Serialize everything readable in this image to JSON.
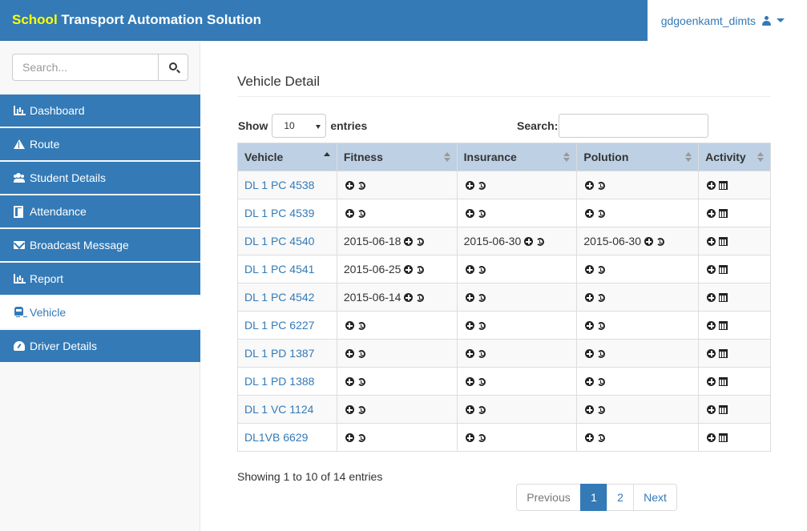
{
  "app": {
    "brand_accent": "School",
    "brand_rest": " Transport Automation Solution",
    "username": "gdgoenkamt_dimts"
  },
  "colors": {
    "primary": "#337ab7",
    "accent": "#ffff00",
    "table_header": "#bdd0e4"
  },
  "sidebar": {
    "search_placeholder": "Search...",
    "items": [
      {
        "label": "Dashboard",
        "icon": "bar-chart-icon"
      },
      {
        "label": "Route",
        "icon": "road-icon"
      },
      {
        "label": "Student Details",
        "icon": "users-icon"
      },
      {
        "label": "Attendance",
        "icon": "files-icon"
      },
      {
        "label": "Broadcast Message",
        "icon": "envelope-icon"
      },
      {
        "label": "Report",
        "icon": "bar-chart-icon"
      },
      {
        "label": "Vehicle",
        "icon": "bus-icon",
        "active": true
      },
      {
        "label": "Driver Details",
        "icon": "dashboard-icon"
      }
    ]
  },
  "main": {
    "title": "Vehicle Detail",
    "show_label": "Show",
    "entries_value": "10",
    "entries_label": "entries",
    "search_label": "Search:",
    "columns": [
      "Vehicle",
      "Fitness",
      "Insurance",
      "Polution",
      "Activity"
    ],
    "rows": [
      {
        "vehicle": "DL 1 PC 4538",
        "fitness": "",
        "insurance": "",
        "polution": ""
      },
      {
        "vehicle": "DL 1 PC 4539",
        "fitness": "",
        "insurance": "",
        "polution": ""
      },
      {
        "vehicle": "DL 1 PC 4540",
        "fitness": "2015-06-18",
        "insurance": "2015-06-30",
        "polution": "2015-06-30"
      },
      {
        "vehicle": "DL 1 PC 4541",
        "fitness": "2015-06-25",
        "insurance": "",
        "polution": ""
      },
      {
        "vehicle": "DL 1 PC 4542",
        "fitness": "2015-06-14",
        "insurance": "",
        "polution": ""
      },
      {
        "vehicle": "DL 1 PC 6227",
        "fitness": "",
        "insurance": "",
        "polution": ""
      },
      {
        "vehicle": "DL 1 PD 1387",
        "fitness": "",
        "insurance": "",
        "polution": ""
      },
      {
        "vehicle": "DL 1 PD 1388",
        "fitness": "",
        "insurance": "",
        "polution": ""
      },
      {
        "vehicle": "DL 1 VC 1124",
        "fitness": "",
        "insurance": "",
        "polution": ""
      },
      {
        "vehicle": "DL1VB 6629",
        "fitness": "",
        "insurance": "",
        "polution": ""
      }
    ],
    "info": "Showing 1 to 10 of 14 entries",
    "pagination": {
      "previous": "Previous",
      "pages": [
        "1",
        "2"
      ],
      "current": "1",
      "next": "Next"
    }
  }
}
